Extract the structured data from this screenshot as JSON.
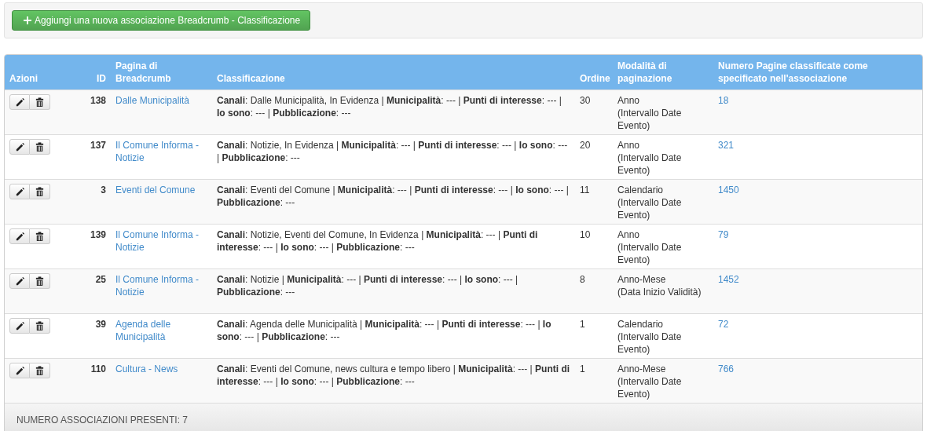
{
  "add_button": {
    "label": "Aggiungi una nuova associazione Breadcrumb - Classificazione"
  },
  "table": {
    "columns": [
      "Azioni",
      "ID",
      "Pagina di Breadcrumb",
      "Classificazione",
      "Ordine",
      "Modalità di paginazione",
      "Numero Pagine classificate come specificato nell'associazione"
    ],
    "rows": [
      {
        "id": "138",
        "page": "Dalle Municipalità",
        "classification": "**Canali**: Dalle Municipalità, In Evidenza | **Municipalità**: --- | **Punti di interesse**: --- | **Io sono**: --- | **Pubblicazione**: ---",
        "order": "30",
        "pagination": {
          "mode": "Anno",
          "basis": "(Intervallo Date Evento)"
        },
        "count": "18"
      },
      {
        "id": "137",
        "page": "Il Comune Informa - Notizie",
        "classification": "**Canali**: Notizie, In Evidenza | **Municipalità**: --- | **Punti di interesse**: --- | **Io sono**: --- | **Pubblicazione**: ---",
        "order": "20",
        "pagination": {
          "mode": "Anno",
          "basis": "(Intervallo Date Evento)"
        },
        "count": "321"
      },
      {
        "id": "3",
        "page": "Eventi del Comune",
        "classification": "**Canali**: Eventi del Comune | **Municipalità**: --- | **Punti di interesse**: --- | **Io sono**: --- | **Pubblicazione**: ---",
        "order": "11",
        "pagination": {
          "mode": "Calendario",
          "basis": "(Intervallo Date Evento)"
        },
        "count": "1450"
      },
      {
        "id": "139",
        "page": "Il Comune Informa - Notizie",
        "classification": "**Canali**: Notizie, Eventi del Comune, In Evidenza | **Municipalità**: --- | **Punti di interesse**: --- | **Io sono**: --- | **Pubblicazione**: ---",
        "order": "10",
        "pagination": {
          "mode": "Anno",
          "basis": "(Intervallo Date Evento)"
        },
        "count": "79"
      },
      {
        "id": "25",
        "page": "Il Comune Informa - Notizie",
        "classification": "**Canali**: Notizie | **Municipalità**: --- | **Punti di interesse**: --- | **Io sono**: --- | **Pubblicazione**: ---",
        "order": "8",
        "pagination": {
          "mode": "Anno-Mese",
          "basis": "(Data Inizio Validità)"
        },
        "count": "1452"
      },
      {
        "id": "39",
        "page": "Agenda delle Municipalità",
        "classification": "**Canali**: Agenda delle Municipalità | **Municipalità**: --- | **Punti di interesse**: --- | **Io sono**: --- | **Pubblicazione**: ---",
        "order": "1",
        "pagination": {
          "mode": "Calendario",
          "basis": "(Intervallo Date Evento)"
        },
        "count": "72"
      },
      {
        "id": "110",
        "page": "Cultura - News",
        "classification": "**Canali**: Eventi del Comune, news cultura e tempo libero | **Municipalità**: --- | **Punti di interesse**: --- | **Io sono**: --- | **Pubblicazione**: ---",
        "order": "1",
        "pagination": {
          "mode": "Anno-Mese",
          "basis": "(Intervallo Date Evento)"
        },
        "count": "766"
      }
    ]
  },
  "footer": {
    "text": "NUMERO ASSOCIAZIONI PRESENTI: 7"
  }
}
